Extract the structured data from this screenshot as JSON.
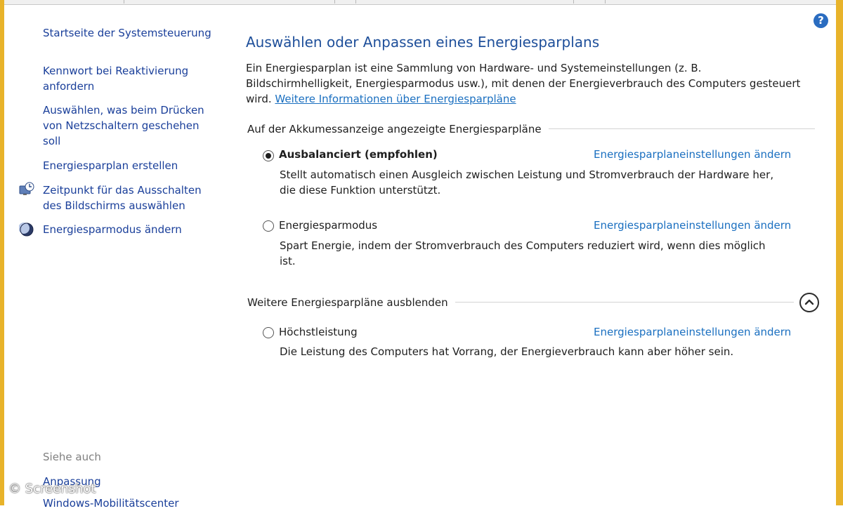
{
  "colors": {
    "frame": "#e8b32a",
    "link": "#1a6fc0",
    "title": "#1e4f9a",
    "sidebar_link": "#1a3f9a"
  },
  "help": {
    "icon": "help-icon",
    "glyph": "?"
  },
  "sidebar": {
    "items": [
      {
        "label_lines": [
          "Startseite der Systemsteuerung"
        ]
      },
      {
        "label_lines": [
          "Kennwort bei Reaktivierung",
          "anfordern"
        ]
      },
      {
        "label_lines": [
          "Auswählen, was beim Drücken",
          "von Netzschaltern geschehen",
          "soll"
        ]
      },
      {
        "label_lines": [
          "Energiesparplan erstellen"
        ]
      },
      {
        "label_lines": [
          "Zeitpunkt für das Ausschalten",
          "des Bildschirms auswählen"
        ],
        "icon": "display-clock-icon"
      },
      {
        "label_lines": [
          "Energiesparmodus ändern"
        ],
        "icon": "moon-icon"
      }
    ],
    "see_also_heading": "Siehe auch",
    "see_also": [
      "Anpassung",
      "Windows-Mobilitätscenter"
    ]
  },
  "main": {
    "title": "Auswählen oder Anpassen eines Energiesparplans",
    "intro_lines": [
      "Ein Energiesparplan ist eine Sammlung von Hardware- und Systemeinstellungen (z. B.",
      "Bildschirmhelligkeit, Energiesparmodus usw.), mit denen der Energieverbrauch des Computers gesteuert"
    ],
    "intro_prefix": "wird.",
    "intro_link": "Weitere Informationen über Energiesparpläne",
    "group_battery": "Auf der Akkumessanzeige angezeigte Energiesparpläne",
    "group_more": "Weitere Energiesparpläne ausblenden",
    "plans": [
      {
        "name": "Ausbalanciert (empfohlen)",
        "selected": true,
        "link": "Energiesparplaneinstellungen ändern",
        "desc_lines": [
          "Stellt automatisch einen Ausgleich zwischen Leistung und Stromverbrauch der Hardware her,",
          "die diese Funktion unterstützt."
        ]
      },
      {
        "name": "Energiesparmodus",
        "selected": false,
        "link": "Energiesparplaneinstellungen ändern",
        "desc_lines": [
          "Spart Energie, indem der Stromverbrauch des Computers reduziert wird, wenn dies möglich",
          "ist."
        ]
      },
      {
        "name": "Höchstleistung",
        "selected": false,
        "link": "Energiesparplaneinstellungen ändern",
        "desc_lines": [
          "Die Leistung des Computers hat Vorrang, der Energieverbrauch kann aber höher sein."
        ]
      }
    ],
    "collapse_icon": "chevron-up-circle-icon"
  },
  "watermark": "© Screenshot"
}
